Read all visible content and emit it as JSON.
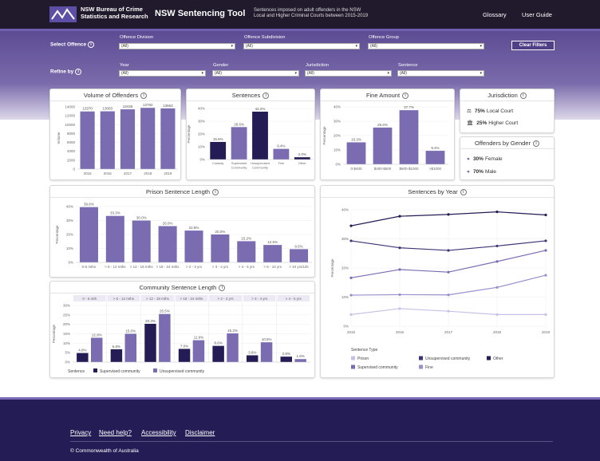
{
  "header": {
    "org": "NSW Bureau of Crime\nStatistics and Research",
    "title": "NSW Sentencing Tool",
    "subtitle": "Sentences imposed on adult offenders in the NSW\nLocal and Higher Criminal Courts between 2015-2019",
    "nav": [
      "Glossary",
      "User Guide"
    ]
  },
  "filters": {
    "select_label": "Select Offence",
    "refine_label": "Refine by",
    "clear": "Clear Filters",
    "offence": [
      {
        "name": "Offence Division",
        "value": "(All)"
      },
      {
        "name": "Offence Subdivision",
        "value": "(All)"
      },
      {
        "name": "Offence Group",
        "value": "(All)"
      }
    ],
    "refine": [
      {
        "name": "Year",
        "value": "(All)"
      },
      {
        "name": "Gender",
        "value": "(All)"
      },
      {
        "name": "Jurisdiction",
        "value": "(All)"
      },
      {
        "name": "Sentence",
        "value": "(All)"
      }
    ]
  },
  "cards": {
    "volume": "Volume of Offenders",
    "sentences": "Sentences",
    "fine": "Fine Amount",
    "jurisdiction": "Jurisdiction",
    "gender": "Offenders by Gender",
    "prison": "Prison Sentence Length",
    "community": "Community Sentence Length",
    "year": "Sentences by Year"
  },
  "jurisdiction": [
    {
      "pct": "75%",
      "label": "Local Court"
    },
    {
      "pct": "25%",
      "label": "Higher Court"
    }
  ],
  "gender": [
    {
      "pct": "30%",
      "label": "Female"
    },
    {
      "pct": "70%",
      "label": "Male"
    }
  ],
  "colors": {
    "dark": "#241c55",
    "mid": "#7b6cb2",
    "light": "#b3a8d9",
    "lighter": "#c9c0e6",
    "header": "#201a2c"
  },
  "chart_data": [
    {
      "id": "volume",
      "type": "bar",
      "categories": [
        "2015",
        "2016",
        "2017",
        "2018",
        "2019"
      ],
      "values": [
        12970,
        13003,
        13446,
        13782,
        13663
      ],
      "labels": [
        "12970",
        "13003",
        "13446",
        "13782",
        "13663"
      ],
      "ylim": [
        0,
        14000
      ],
      "yticks": [
        "0",
        "2000",
        "4000",
        "6000",
        "8000",
        "10000",
        "12000",
        "14000"
      ],
      "ylabel": "Volume"
    },
    {
      "id": "sentences",
      "type": "bar",
      "categories": [
        "Custody",
        "Supervised Community",
        "Unsupervised Community",
        "Fine",
        "Other"
      ],
      "values": [
        15.5,
        28.6,
        42.2,
        9.4,
        2.0
      ],
      "labels": [
        "15.5%",
        "28.6%",
        "42.2%",
        "9.4%",
        "2.0%"
      ],
      "colors": [
        "#241c55",
        "#7b6cb2",
        "#241c55",
        "#7b6cb2",
        "#241c55"
      ],
      "ylim": [
        0,
        45
      ],
      "yticks": [
        "0%",
        "10%",
        "20%",
        "30%",
        "40%"
      ],
      "ylabel": "Percentage"
    },
    {
      "id": "fine",
      "type": "bar",
      "categories": [
        "0-$400",
        "$400-$600",
        "$600-$1000",
        ">$1000"
      ],
      "values": [
        15.3,
        25.6,
        37.7,
        9.4
      ],
      "labels": [
        "15.3%",
        "25.6%",
        "37.7%",
        "9.4%"
      ],
      "ylim": [
        0,
        40
      ],
      "yticks": [
        "0%",
        "10%",
        "20%",
        "30%",
        "40%"
      ],
      "ylabel": "Percentage"
    },
    {
      "id": "prison",
      "type": "bar",
      "categories": [
        "0-6 mths",
        "> 6 - 12 mths",
        "> 12 - 18 mths",
        "> 18 - 24 mths",
        "> 2 - 3 yrs",
        "> 3 - 4 yrs",
        "> 4 - 5 yrs",
        "> 5 - 10 yrs",
        "> 10 yrs/Life"
      ],
      "values": [
        39.6,
        33.3,
        30.0,
        26.0,
        22.8,
        20.0,
        15.2,
        12.5,
        9.5
      ],
      "labels": [
        "39.6%",
        "33.3%",
        "30.0%",
        "26.0%",
        "22.8%",
        "20.0%",
        "15.2%",
        "12.5%",
        "9.5%"
      ],
      "ylim": [
        0,
        40
      ],
      "yticks": [
        "0%",
        "10%",
        "20%",
        "30%",
        "40%"
      ],
      "ylabel": "Percentage"
    },
    {
      "id": "community",
      "type": "bar",
      "groups": [
        "0 - 6 mth",
        "> 6 - 12 mths",
        "> 12 - 18 mths",
        "> 18 - 24 mths",
        "> 2 - 3 yrs",
        "> 3 - 4 yrs",
        "> 4 - 5 yrs"
      ],
      "series": [
        {
          "name": "Supervised community",
          "color": "#241c55",
          "values": [
            4.8,
            6.8,
            20.3,
            7.0,
            8.6,
            3.6,
            2.9
          ],
          "labels": [
            "4.8%",
            "6.8%",
            "20.3%",
            "7.0%",
            "8.6%",
            "3.6%",
            "2.9%"
          ]
        },
        {
          "name": "Unsupervised community",
          "color": "#7b6cb2",
          "values": [
            12.9,
            15.0,
            25.5,
            11.6,
            15.2,
            10.5,
            1.6
          ],
          "labels": [
            "12.9%",
            "15.0%",
            "25.5%",
            "11.6%",
            "15.2%",
            "10.5%",
            "1.6%"
          ]
        }
      ],
      "ylim": [
        0,
        30
      ],
      "yticks": [
        "0%",
        "5%",
        "10%",
        "15%",
        "20%",
        "25%",
        "30%"
      ],
      "ylabel": "Percentage",
      "legend_title": "Sentence"
    },
    {
      "id": "year",
      "type": "line",
      "x": [
        "2015",
        "2016",
        "2017",
        "2018",
        "2019"
      ],
      "series": [
        {
          "name": "Other",
          "color": "#241c55",
          "values": [
            38.8,
            42.5,
            43.2,
            44.2,
            43.0
          ]
        },
        {
          "name": "Unsupervised community",
          "color": "#3d3575",
          "values": [
            33.0,
            30.3,
            29.3,
            31.0,
            33.0
          ]
        },
        {
          "name": "Supervised community",
          "color": "#7b6cb2",
          "values": [
            18.7,
            21.9,
            20.9,
            25.0,
            29.3
          ]
        },
        {
          "name": "Fine",
          "color": "#9a8dcc",
          "values": [
            12.0,
            12.2,
            12.1,
            15.0,
            19.7
          ]
        },
        {
          "name": "Prison",
          "color": "#c9c0e6",
          "values": [
            4.5,
            6.8,
            5.8,
            4.5,
            4.5
          ]
        }
      ],
      "ylim": [
        0,
        45
      ],
      "yticks": [
        "0%",
        "10%",
        "20%",
        "30%",
        "40%"
      ],
      "ylabel": "Percentage",
      "legend_title": "Sentence Type",
      "legend": [
        "Prison",
        "Unsupervised community",
        "Other",
        "Supervised community",
        "Fine"
      ]
    }
  ],
  "footer": {
    "links": [
      "Privacy",
      "Need help?",
      "Accessibility",
      "Disclaimer"
    ],
    "copyright": "© Commonwealth of Australia"
  }
}
